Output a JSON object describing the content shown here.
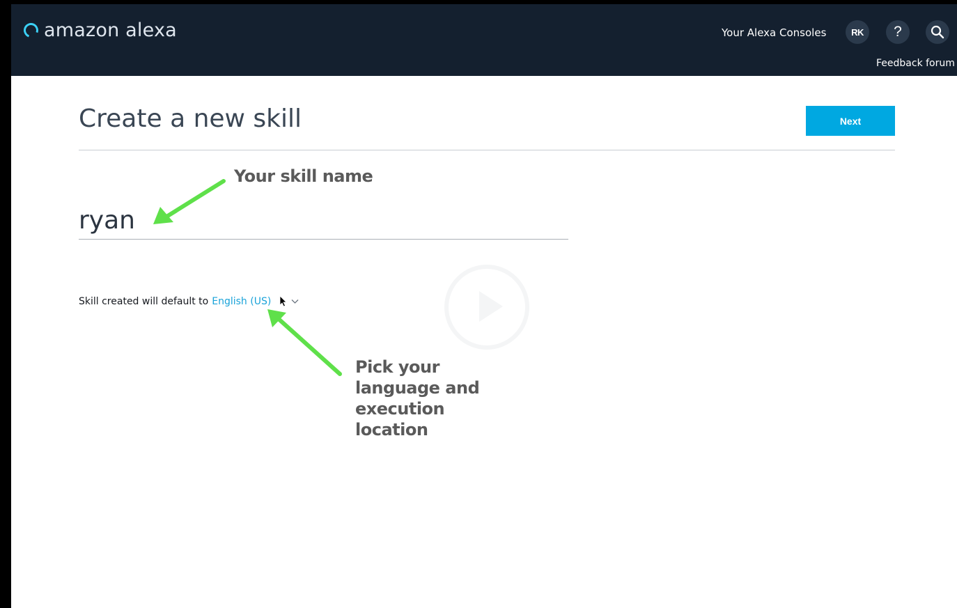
{
  "header": {
    "logo_text": "amazon alexa",
    "consoles_link": "Your Alexa Consoles",
    "avatar_initials": "RK",
    "help_label": "?",
    "feedback_link": "Feedback forum"
  },
  "main": {
    "title": "Create a new skill",
    "next_label": "Next",
    "skill_name_value": "ryan",
    "locale_prefix": "Skill created will default to",
    "locale_value": "English (US)"
  },
  "annotations": {
    "skill_name": "Your skill name",
    "language_lines": [
      "Pick your",
      "language and",
      "execution",
      "location"
    ]
  },
  "colors": {
    "header_bg": "#14202f",
    "accent": "#00a8e1",
    "link": "#1aa3d9",
    "annotation_arrow": "#5fe04a"
  },
  "icons": {
    "logo": "alexa-ring-icon",
    "help": "help-icon",
    "search": "search-icon",
    "cursor": "mouse-cursor-icon",
    "dropdown": "chevron-down-icon"
  }
}
